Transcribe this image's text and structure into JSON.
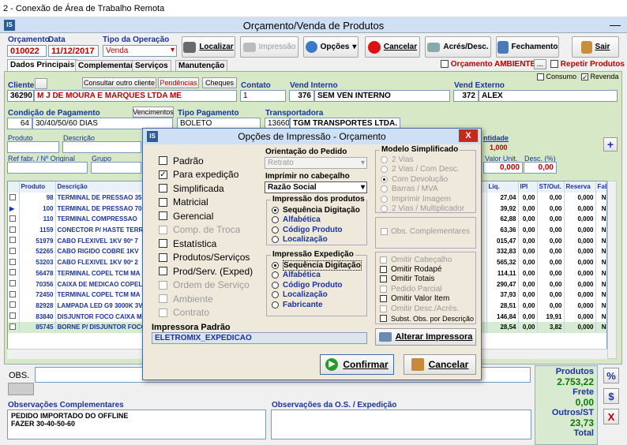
{
  "window": {
    "title": "2 - Conexão de Área de Trabalho Remota",
    "app_title": "Orçamento/Venda de Produtos"
  },
  "header": {
    "orc_label": "Orçamento",
    "data_label": "Data",
    "tipo_label": "Tipo da Operação",
    "orc_value": "010022",
    "data_value": "11/12/2017",
    "tipo_value": "Venda"
  },
  "toolbar": {
    "localizar": "Localizar",
    "impressao": "Impressão",
    "opcoes": "Opções",
    "cancelar": "Cancelar",
    "acres": "Acrés/Desc.",
    "fechamento": "Fechamento",
    "sair": "Sair"
  },
  "tabs": [
    "Dados Principais",
    "Complementar",
    "Serviços",
    "Manutenção"
  ],
  "flags": {
    "orc_ambiente": "Orçamento AMBIENTE",
    "ellipsis": "...",
    "repetir": "Repetir Produtos",
    "consumo": "Consumo",
    "revenda": "Revenda"
  },
  "cliente": {
    "label": "Cliente",
    "consultar": "Consultar outro cliente",
    "pendencias": "Pendências",
    "cheques": "Cheques",
    "code": "36290",
    "name": "M J DE MOURA E MARQUES LTDA ME"
  },
  "contato": {
    "label": "Contato",
    "value": "1"
  },
  "vint": {
    "label": "Vend Interno",
    "code": "376",
    "name": "SEM VEN INTERNO"
  },
  "vext": {
    "label": "Vend Externo",
    "code": "372",
    "name": "ALEX"
  },
  "cond": {
    "label": "Condição de Pagamento",
    "vencimentos": "Vencimentos",
    "code": "64",
    "value": "30/40/50/60 DIAS"
  },
  "tipopag": {
    "label": "Tipo Pagamento",
    "value": "BOLETO"
  },
  "transp": {
    "label": "Transportadora",
    "code": "13660",
    "name": "TGM TRANSPORTES LTDA."
  },
  "prod_area": {
    "produto": "Produto",
    "descricao": "Descrição",
    "quantidade": "ntidade",
    "qtd_value": "1,000",
    "ref": "Ref fabr. / Nº Original",
    "grupo": "Grupo",
    "valor_unit": "Valor Unit.",
    "vu_value": "0,000",
    "desc": "Desc. (%)",
    "desc_value": "0,00",
    "plus": "+"
  },
  "grid": {
    "headers": [
      "Produto",
      "Descrição",
      "Liq.",
      "IPI",
      "ST/Out.",
      "Reserva",
      "Fab"
    ],
    "rows": [
      [
        "98",
        "TERMINAL DE PRESSAO 35",
        "27,04",
        "0,00",
        "0,00",
        "0,000",
        "N"
      ],
      [
        "100",
        "TERMINAL DE PRESSAO 70",
        "39,92",
        "0,00",
        "0,00",
        "0,000",
        "N"
      ],
      [
        "110",
        "TERMINAL COMPRESSAO",
        "62,88",
        "0,00",
        "0,00",
        "0,000",
        "N"
      ],
      [
        "1159",
        "CONECTOR P/ HASTE TERR",
        "63,36",
        "0,00",
        "0,00",
        "0,000",
        "N"
      ],
      [
        "51979",
        "CABO FLEXIVEL 1KV 90º 7",
        "015,47",
        "0,00",
        "0,00",
        "0,000",
        "N"
      ],
      [
        "52265",
        "CABO RIGIDO COBRE 1KV",
        "332,83",
        "0,00",
        "0,00",
        "0,000",
        "N"
      ],
      [
        "53203",
        "CABO FLEXIVEL 1KV 90º 2",
        "565,32",
        "0,00",
        "0,00",
        "0,000",
        "N"
      ],
      [
        "56478",
        "TERMINAL COPEL TCM MA",
        "114,11",
        "0,00",
        "0,00",
        "0,000",
        "N"
      ],
      [
        "70356",
        "CAIXA DE MEDICAO COPEL",
        "290,47",
        "0,00",
        "0,00",
        "0,000",
        "N"
      ],
      [
        "72450",
        "TERMINAL COPEL TCM MA",
        "37,93",
        "0,00",
        "0,00",
        "0,000",
        "N"
      ],
      [
        "82928",
        "LAMPADA LED G9 3000K 3V",
        "28,51",
        "0,00",
        "0,00",
        "0,000",
        "N"
      ],
      [
        "83840",
        "DISJUNTOR FOCO CAIXA M",
        "146,84",
        "0,00",
        "19,91",
        "0,000",
        "N"
      ],
      [
        "85745",
        "BORNE P/ DISJUNTOR FOCO",
        "28,54",
        "0,00",
        "3,82",
        "0,000",
        "N"
      ]
    ]
  },
  "obs": {
    "label": "OBS.",
    "comp_label": "Observações Complementares",
    "comp_lines": [
      "PEDIDO IMPORTADO DO OFFLINE",
      "FAZER 30-40-50-60"
    ],
    "os_label": "Observações da O.S. / Expedição"
  },
  "totals": {
    "produtos_label": "Produtos",
    "produtos_value": "2.753,22",
    "frete_label": "Frete",
    "frete_value": "0,00",
    "outros_label": "Outros/ST",
    "outros_value": "23,73",
    "total_label": "Total",
    "pct": "%",
    "dollar": "$",
    "x": "X"
  },
  "dialog": {
    "title": "Opções de Impressão - Orçamento",
    "close": "X",
    "options": [
      {
        "label": "Padrão",
        "checked": false,
        "enabled": true
      },
      {
        "label": "Para expedição",
        "checked": true,
        "enabled": true
      },
      {
        "label": "Simplificada",
        "checked": false,
        "enabled": true
      },
      {
        "label": "Matricial",
        "checked": false,
        "enabled": true
      },
      {
        "label": "Gerencial",
        "checked": false,
        "enabled": true
      },
      {
        "label": "Comp. de Troca",
        "checked": false,
        "enabled": false
      },
      {
        "label": "Estatística",
        "checked": false,
        "enabled": true
      },
      {
        "label": "Produtos/Serviços",
        "checked": false,
        "enabled": true
      },
      {
        "label": "Prod/Serv. (Exped)",
        "checked": false,
        "enabled": true
      },
      {
        "label": "Ordem de Serviço",
        "checked": false,
        "enabled": false
      },
      {
        "label": "Ambiente",
        "checked": false,
        "enabled": false
      },
      {
        "label": "Contrato",
        "checked": false,
        "enabled": false
      }
    ],
    "orient_label": "Orientação do Pedido",
    "orient_value": "Retrato",
    "cab_label": "Imprimir no cabeçalho",
    "cab_value": "Razão Social",
    "imp_prod_title": "Impressão dos produtos",
    "imp_prod": [
      "Sequência Digitação",
      "Alfabética",
      "Código Produto",
      "Localização"
    ],
    "imp_exp_title": "Impressão Expedição",
    "imp_exp": [
      "Sequência Digitação",
      "Alfabética",
      "Código Produto",
      "Localização",
      "Fabricante"
    ],
    "modelo_title": "Modelo Simplificado",
    "modelo": [
      "2 Vias",
      "2 Vias / Com Desc.",
      "Com Devolução",
      "Barras / MVA",
      "Imprimir Imagem",
      "2 Vias / Multiplicador"
    ],
    "obs_comp": "Obs. Complementares",
    "omitir": [
      {
        "label": "Omitir Cabeçalho",
        "enabled": false
      },
      {
        "label": "Omitir Rodapé",
        "enabled": true
      },
      {
        "label": "Omitir Totais",
        "enabled": true
      },
      {
        "label": "Pedido Parcial",
        "enabled": false
      },
      {
        "label": "Omitir Valor Item",
        "enabled": true
      },
      {
        "label": "Omitir Desc./Acrés.",
        "enabled": false
      },
      {
        "label": "Subst. Obs. por Descrição",
        "enabled": true
      }
    ],
    "impressora_label": "Impressora Padrão",
    "impressora_value": "ELETROMIX_EXPEDICAO",
    "alterar": "Alterar Impressora",
    "confirmar": "Confirmar",
    "cancelar": "Cancelar"
  },
  "colors": {
    "accent": "#1a33a0",
    "title_bar": "#cfe0f4",
    "dialog_bg": "#efe9dc",
    "total_green": "#d8ead0",
    "red": "#c00000"
  }
}
